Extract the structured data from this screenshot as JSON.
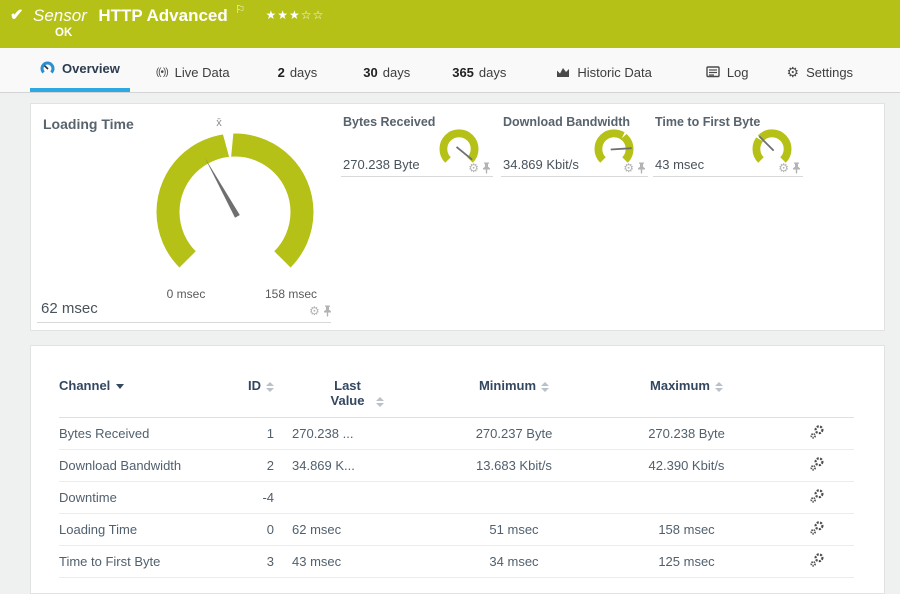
{
  "header": {
    "kind": "Sensor",
    "title": "HTTP Advanced",
    "status": "OK",
    "stars": "★★★☆☆",
    "color": "#b5c117"
  },
  "tabs": [
    {
      "label": "Overview",
      "active": true
    },
    {
      "label": "Live Data"
    },
    {
      "num": "2",
      "label": "days"
    },
    {
      "num": "30",
      "label": "days"
    },
    {
      "num": "365",
      "label": "days"
    },
    {
      "label": "Historic Data"
    },
    {
      "label": "Log"
    },
    {
      "label": "Settings"
    }
  ],
  "gauges": {
    "primary": {
      "title": "Loading Time",
      "value": "62 msec",
      "scale_min": "0 msec",
      "scale_max": "158 msec",
      "mean_marker": "x̄"
    },
    "small": [
      {
        "title": "Bytes Received",
        "value": "270.238 Byte"
      },
      {
        "title": "Download Bandwidth",
        "value": "34.869 Kbit/s"
      },
      {
        "title": "Time to First Byte",
        "value": "43 msec"
      }
    ]
  },
  "channel_table": {
    "headers": {
      "channel": "Channel",
      "id": "ID",
      "last_value": "Last Value",
      "minimum": "Minimum",
      "maximum": "Maximum"
    },
    "rows": [
      {
        "channel": "Bytes Received",
        "id": "1",
        "last": "270.238 ...",
        "min": "270.237 Byte",
        "max": "270.238 Byte"
      },
      {
        "channel": "Download Bandwidth",
        "id": "2",
        "last": "34.869 K...",
        "min": "13.683 Kbit/s",
        "max": "42.390 Kbit/s"
      },
      {
        "channel": "Downtime",
        "id": "-4",
        "last": "",
        "min": "",
        "max": ""
      },
      {
        "channel": "Loading Time",
        "id": "0",
        "last": "62 msec",
        "min": "51 msec",
        "max": "158 msec"
      },
      {
        "channel": "Time to First Byte",
        "id": "3",
        "last": "43 msec",
        "min": "34 msec",
        "max": "125 msec"
      }
    ]
  },
  "colors": {
    "accent_green": "#b5c117",
    "accent_blue": "#2fa8e1"
  }
}
